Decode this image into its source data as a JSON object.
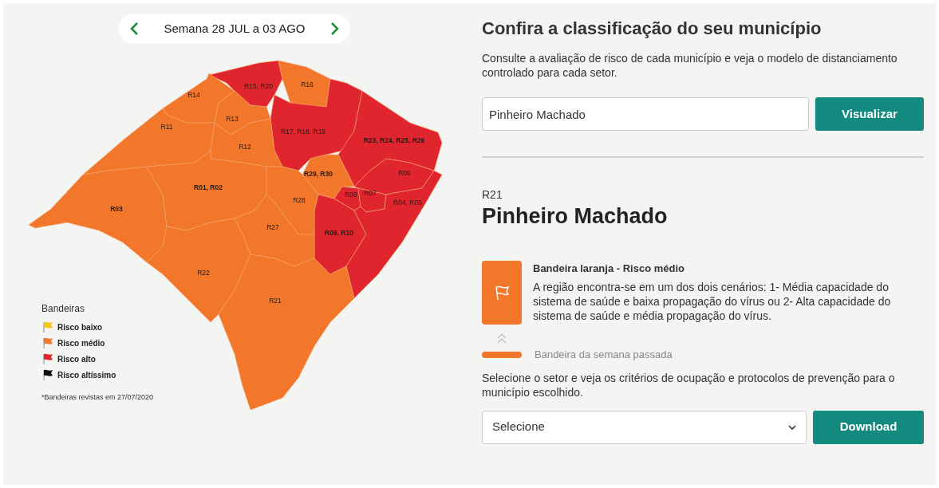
{
  "week_nav": {
    "label": "Semana 28 JUL a 03 AGO"
  },
  "map": {
    "regions": [
      {
        "label": "R03",
        "color": "#f2772a"
      },
      {
        "label": "R15, R20",
        "color": "#e0252f"
      },
      {
        "label": "R16",
        "color": "#f2772a"
      },
      {
        "label": "R17, R18, R19",
        "color": "#e0252f"
      },
      {
        "label": "R23, R24, R25, R26",
        "color": "#e0252f"
      },
      {
        "label": "R29, R30",
        "color": "#f2772a"
      },
      {
        "label": "R06",
        "color": "#e0252f"
      },
      {
        "label": "R09, R10",
        "color": "#e0252f"
      },
      {
        "label": "R14",
        "color": "#f2772a"
      },
      {
        "label": "R11",
        "color": "#f2772a"
      },
      {
        "label": "R13",
        "color": "#f2772a"
      },
      {
        "label": "R12",
        "color": "#f2772a"
      },
      {
        "label": "R01, R02",
        "color": "#f2772a"
      },
      {
        "label": "R08",
        "color": "#e0252f"
      },
      {
        "label": "R07",
        "color": "#e0252f"
      },
      {
        "label": "R04, R05",
        "color": "#e0252f"
      },
      {
        "label": "R28",
        "color": "#f2772a"
      },
      {
        "label": "R27",
        "color": "#f2772a"
      },
      {
        "label": "R22",
        "color": "#f2772a"
      },
      {
        "label": "R21",
        "color": "#f2772a"
      }
    ]
  },
  "legend": {
    "title": "Bandeiras",
    "items": [
      {
        "label": "Risco baixo",
        "color": "#f5c518"
      },
      {
        "label": "Risco médio",
        "color": "#f2772a"
      },
      {
        "label": "Risco alto",
        "color": "#e0252f"
      },
      {
        "label": "Risco altíssimo",
        "color": "#111111"
      }
    ],
    "note": "*Bandeiras revistas em 27/07/2020"
  },
  "panel": {
    "title": "Confira a classificação do seu município",
    "description": "Consulte a avaliação de risco de cada município e veja o modelo de distanciamento controlado para cada setor.",
    "search": {
      "value": "Pinheiro Machado"
    },
    "search_button": "Visualizar",
    "region_code": "R21",
    "municipality": "Pinheiro Machado",
    "flag": {
      "color": "#f2772a",
      "title": "Bandeira laranja - Risco médio",
      "description": "A região encontra-se em um dos dois cenários: 1- Média capacidade do sistema de saúde e baixa propagação do vírus ou 2- Alta capacidade do sistema de saúde e média propagação do vírus."
    },
    "last_week": {
      "color": "#f2772a",
      "label": "Bandeira da semana passada"
    },
    "sector_text": "Selecione o setor e veja os critérios de ocupação e protocolos de prevenção para o município escolhido.",
    "sector_select": {
      "value": "Selecione"
    },
    "download_button": "Download"
  }
}
